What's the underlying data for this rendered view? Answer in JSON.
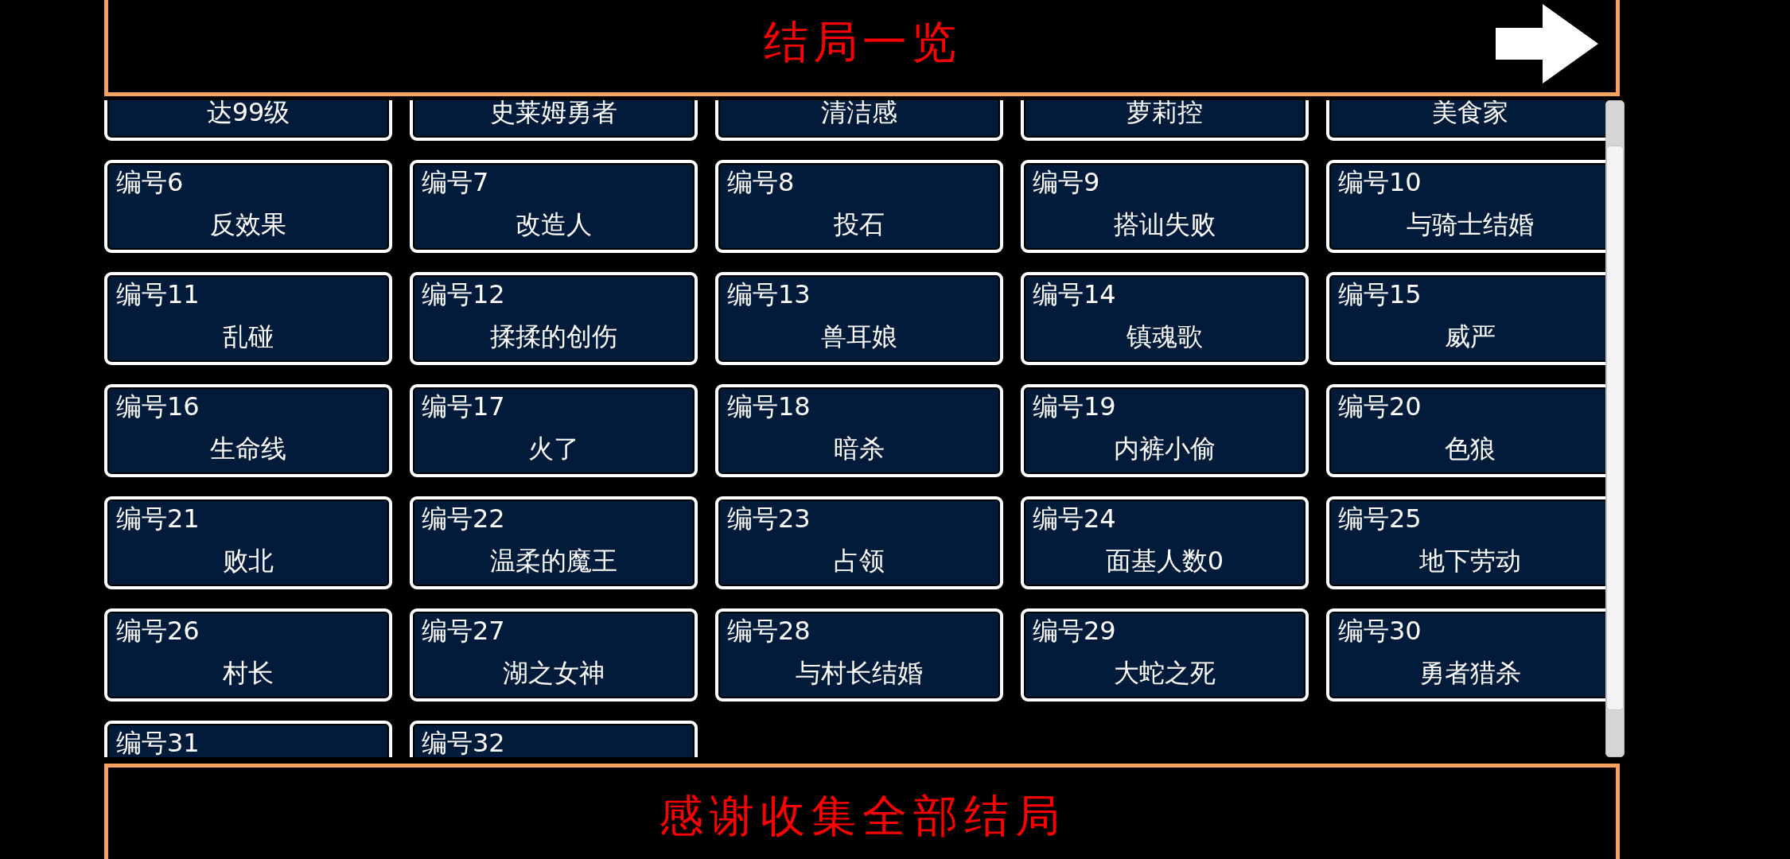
{
  "title_bar": {
    "title": "结局一览"
  },
  "endings": [
    {
      "name": "达99级"
    },
    {
      "name": "史莱姆勇者"
    },
    {
      "name": "清洁感"
    },
    {
      "name": "萝莉控"
    },
    {
      "name": "美食家"
    },
    {
      "number": "编号6",
      "name": "反效果"
    },
    {
      "number": "编号7",
      "name": "改造人"
    },
    {
      "number": "编号8",
      "name": "投石"
    },
    {
      "number": "编号9",
      "name": "搭讪失败"
    },
    {
      "number": "编号10",
      "name": "与骑士结婚"
    },
    {
      "number": "编号11",
      "name": "乱碰"
    },
    {
      "number": "编号12",
      "name": "揉揉的创伤"
    },
    {
      "number": "编号13",
      "name": "兽耳娘"
    },
    {
      "number": "编号14",
      "name": "镇魂歌"
    },
    {
      "number": "编号15",
      "name": "威严"
    },
    {
      "number": "编号16",
      "name": "生命线"
    },
    {
      "number": "编号17",
      "name": "火了"
    },
    {
      "number": "编号18",
      "name": "暗杀"
    },
    {
      "number": "编号19",
      "name": "内裤小偷"
    },
    {
      "number": "编号20",
      "name": "色狼"
    },
    {
      "number": "编号21",
      "name": "败北"
    },
    {
      "number": "编号22",
      "name": "温柔的魔王"
    },
    {
      "number": "编号23",
      "name": "占领"
    },
    {
      "number": "编号24",
      "name": "面基人数0"
    },
    {
      "number": "编号25",
      "name": "地下劳动"
    },
    {
      "number": "编号26",
      "name": "村长"
    },
    {
      "number": "编号27",
      "name": "湖之女神"
    },
    {
      "number": "编号28",
      "name": "与村长结婚"
    },
    {
      "number": "编号29",
      "name": "大蛇之死"
    },
    {
      "number": "编号30",
      "name": "勇者猎杀"
    },
    {
      "number": "编号31"
    },
    {
      "number": "编号32"
    }
  ],
  "footer": {
    "message": "感谢收集全部结局"
  }
}
